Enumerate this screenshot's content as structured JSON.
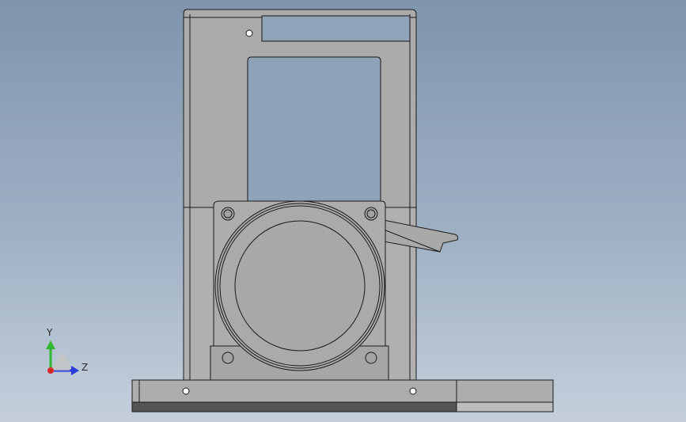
{
  "viewport": {
    "background_top": "#7f95ad",
    "background_bottom": "#c4cfdb",
    "model_fill": "#ababab",
    "model_fill_light": "#b5b5b5",
    "edge_color": "#1a1a1a"
  },
  "triad": {
    "y_label": "Y",
    "z_label": "Z",
    "y_color": "#2fb52f",
    "z_color": "#2a3bd6",
    "origin_color": "#d62a2a"
  }
}
